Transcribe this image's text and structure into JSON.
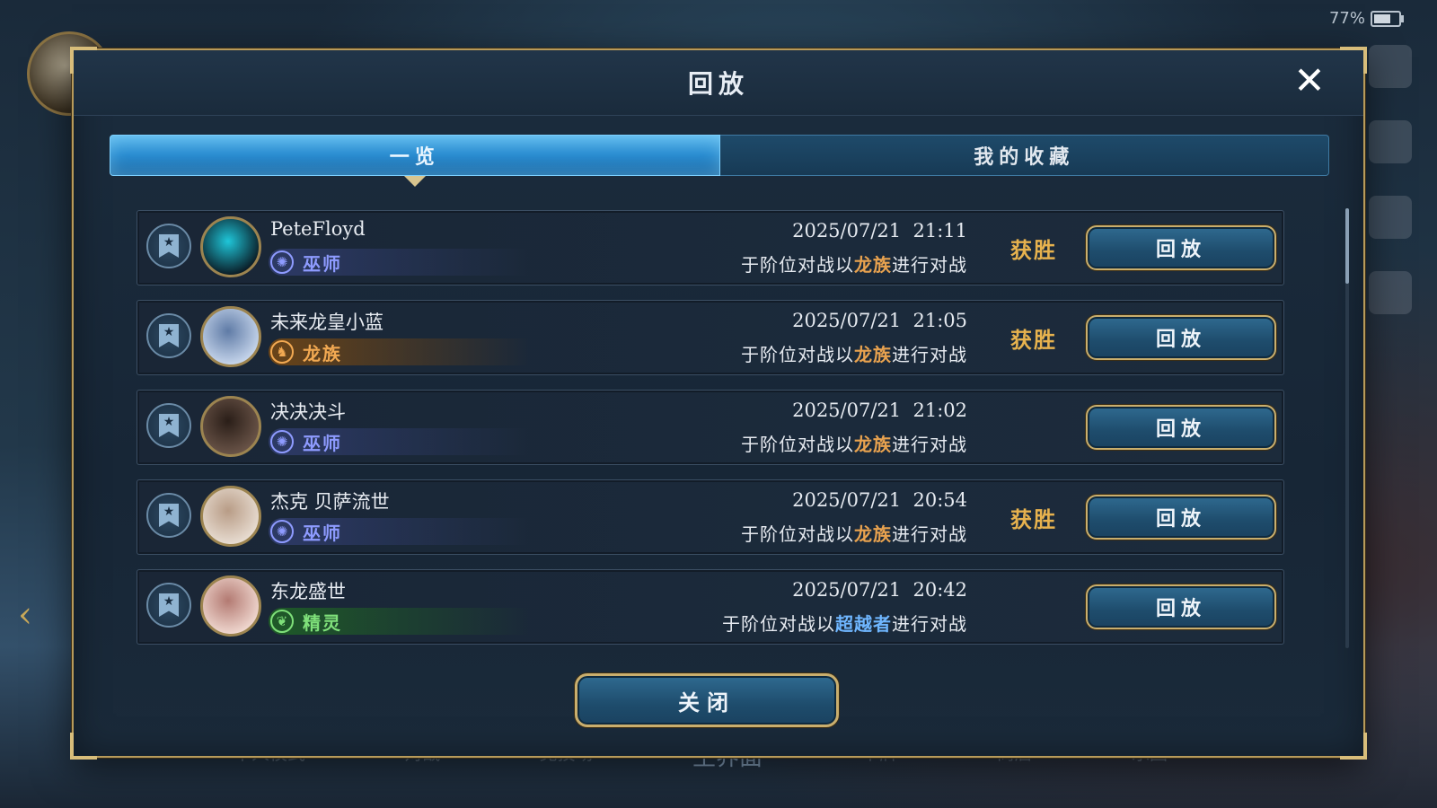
{
  "status": {
    "battery": "77%",
    "battery_level": 0.77
  },
  "background": {
    "nav": [
      "单人模式",
      "对战",
      "竞技场",
      "主界面",
      "卡牌",
      "商店",
      "乐园"
    ],
    "active_nav_index": 3
  },
  "modal": {
    "title": "回放",
    "close_icon": "✕",
    "tabs": [
      {
        "label": "一览",
        "active": true
      },
      {
        "label": "我的收藏",
        "active": false
      }
    ],
    "replay_label": "回放",
    "close_label": "关闭",
    "records": [
      {
        "name": "PeteFloyd",
        "class": "巫师",
        "class_color": "#8e9bff",
        "class_bg": "#2d3a66",
        "class_icon": "✺",
        "date": "2025/07/21  21:11",
        "desc_pre": "于阶位对战以",
        "desc_hl": "龙族",
        "desc_hl_color": "#e8a24f",
        "desc_post": "进行对战",
        "result": "获胜",
        "avatar_colors": [
          "#0a1a24",
          "#1fc6d9"
        ]
      },
      {
        "name": "未来龙皇小蓝",
        "class": "龙族",
        "class_color": "#f2a952",
        "class_bg": "#6a4418",
        "class_icon": "♞",
        "date": "2025/07/21  21:05",
        "desc_pre": "于阶位对战以",
        "desc_hl": "龙族",
        "desc_hl_color": "#e8a24f",
        "desc_post": "进行对战",
        "result": "获胜",
        "avatar_colors": [
          "#c7d6ec",
          "#5f7ba6"
        ]
      },
      {
        "name": "决决决斗",
        "class": "巫师",
        "class_color": "#8e9bff",
        "class_bg": "#2d3a66",
        "class_icon": "✺",
        "date": "2025/07/21  21:02",
        "desc_pre": "于阶位对战以",
        "desc_hl": "龙族",
        "desc_hl_color": "#e8a24f",
        "desc_post": "进行对战",
        "result": "",
        "avatar_colors": [
          "#6a5448",
          "#2a1e18"
        ]
      },
      {
        "name": "杰克 贝萨流世",
        "class": "巫师",
        "class_color": "#8e9bff",
        "class_bg": "#2d3a66",
        "class_icon": "✺",
        "date": "2025/07/21  20:54",
        "desc_pre": "于阶位对战以",
        "desc_hl": "龙族",
        "desc_hl_color": "#e8a24f",
        "desc_post": "进行对战",
        "result": "获胜",
        "avatar_colors": [
          "#e8ddd2",
          "#b89c86"
        ]
      },
      {
        "name": "东龙盛世",
        "class": "精灵",
        "class_color": "#7fe07a",
        "class_bg": "#1f5a28",
        "class_icon": "❦",
        "date": "2025/07/21  20:42",
        "desc_pre": "于阶位对战以",
        "desc_hl": "超越者",
        "desc_hl_color": "#6fb6ff",
        "desc_post": "进行对战",
        "result": "",
        "avatar_colors": [
          "#f0d8d0",
          "#b37a72"
        ]
      }
    ]
  }
}
